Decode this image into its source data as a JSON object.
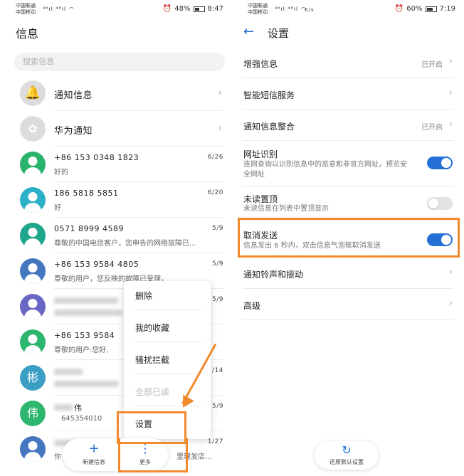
{
  "left_status": {
    "carrier1": "中国联通",
    "carrier2": "中国移动",
    "signal": "⁴⁶ıl ⁴⁶ıl ◠",
    "battery": "48%",
    "time": "8:47",
    "alarm": "⏰"
  },
  "right_status": {
    "carrier1": "中国联通",
    "carrier2": "中国移动",
    "signal": "⁴⁶ıl ⁴⁶ıl ◠",
    "speed": "K/s",
    "battery": "60%",
    "time": "7:19",
    "alarm": "⏰"
  },
  "messages": {
    "title": "信息",
    "search_placeholder": "搜索信息",
    "items": [
      {
        "name": "通知信息",
        "snippet": "",
        "date": ""
      },
      {
        "name": "华为通知",
        "snippet": "",
        "date": ""
      },
      {
        "name": "+86 153 0348 1823",
        "snippet": "好的",
        "date": "6/26"
      },
      {
        "name": "186 5818 5851",
        "snippet": "好",
        "date": "6/20"
      },
      {
        "name": "0571 8999 4589",
        "snippet": "尊敬的中国电信客户，您申告的网络故障已...",
        "date": "5/9"
      },
      {
        "name": "+86 153 9584 4805",
        "snippet": "尊敬的用户，您反映的故障已受理，",
        "date": "5/9"
      },
      {
        "name": "",
        "snippet": "",
        "date": "5/9"
      },
      {
        "name": "+86 153 9584",
        "snippet": "尊敬的用户:您好,",
        "date": ""
      },
      {
        "name": "",
        "snippet": "",
        "date": "/14"
      },
      {
        "name": "伟",
        "snippet": "645354010",
        "date": "5/9"
      },
      {
        "name": "",
        "snippet": "你",
        "date": "1/27"
      }
    ],
    "avatar_letters": {
      "bin": "彬",
      "wei": "伟"
    },
    "tail_snippet": "里理发店..."
  },
  "popup": {
    "items": [
      "删除",
      "我的收藏",
      "骚扰拦截",
      "全部已读",
      "设置"
    ]
  },
  "bottom_bar": {
    "new_label": "新建信息",
    "more_label": "更多",
    "new_glyph": "+",
    "more_glyph": "⋮"
  },
  "settings": {
    "title": "设置",
    "back_glyph": "←",
    "rows": [
      {
        "label": "增强信息",
        "value": "已开启"
      },
      {
        "label": "智能短信服务",
        "value": ""
      },
      {
        "label": "通知信息整合",
        "value": "已开启"
      },
      {
        "label": "网址识别",
        "sub": "连网查询以识别信息中的恶意和非官方网址，预览安全网址",
        "toggle": "on"
      },
      {
        "label": "未读置顶",
        "sub": "未读信息在列表中置顶显示",
        "toggle": "off"
      },
      {
        "label": "取消发送",
        "sub": "信息发出 6 秒内，双击信息气泡框取消发送",
        "toggle": "on"
      },
      {
        "label": "通知铃声和振动",
        "value": ""
      },
      {
        "label": "高级",
        "value": ""
      }
    ],
    "reset_label": "还原默认设置",
    "reset_glyph": "↻"
  },
  "colors": {
    "accent": "#2470d6",
    "highlight": "#f08a2c"
  }
}
